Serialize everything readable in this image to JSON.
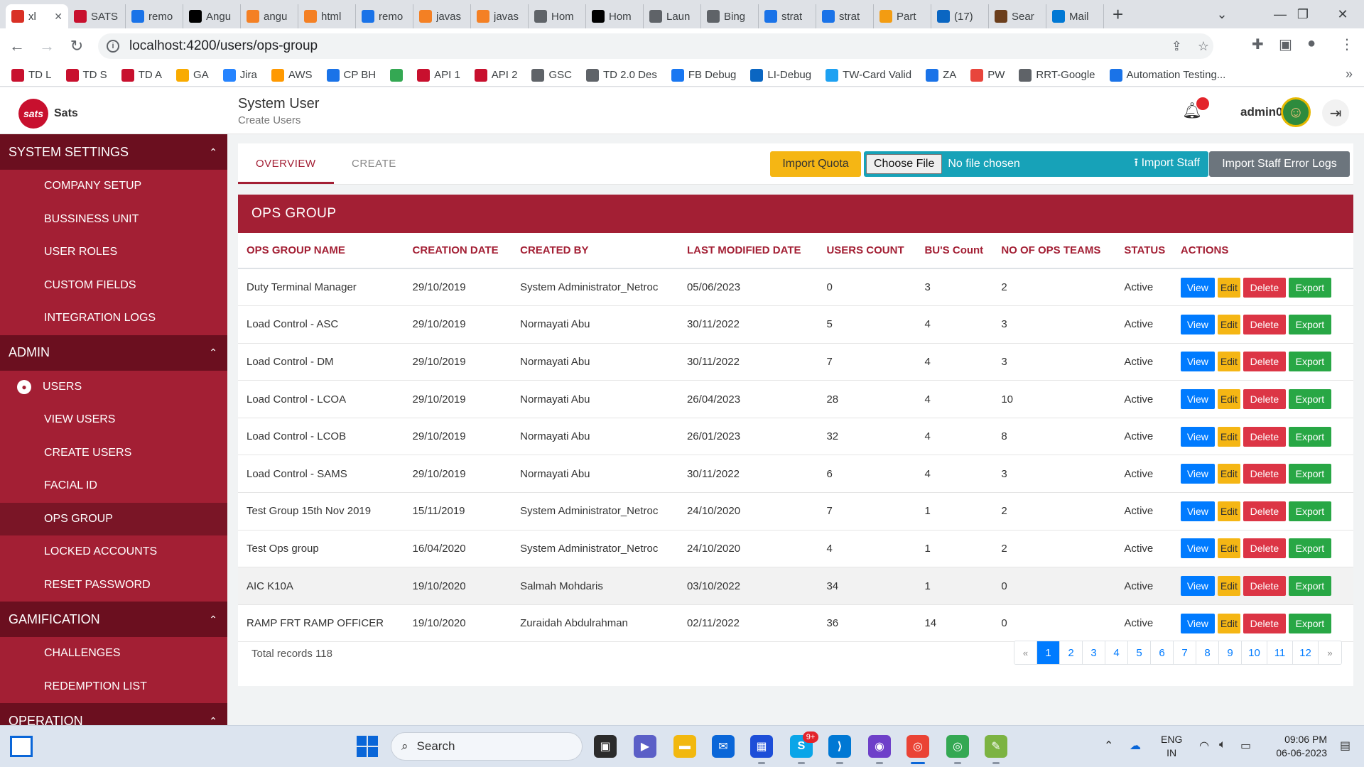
{
  "browser": {
    "tabs": [
      {
        "label": "xl",
        "color": "#d93025",
        "icon": "chrome-loader-icon",
        "active": true
      },
      {
        "label": "SATS",
        "color": "#c8102e",
        "icon": "sats-favicon"
      },
      {
        "label": "remo",
        "color": "#1a73e8",
        "icon": "search-icon"
      },
      {
        "label": "Angu",
        "color": "#000000",
        "icon": "dev-favicon"
      },
      {
        "label": "angu",
        "color": "#f48024",
        "icon": "stackoverflow-favicon"
      },
      {
        "label": "html",
        "color": "#f48024",
        "icon": "stackoverflow-favicon"
      },
      {
        "label": "remo",
        "color": "#1a73e8",
        "icon": "search-icon"
      },
      {
        "label": "javas",
        "color": "#f48024",
        "icon": "stackoverflow-favicon"
      },
      {
        "label": "javas",
        "color": "#f48024",
        "icon": "stackoverflow-favicon"
      },
      {
        "label": "Hom",
        "color": "#5f6368",
        "icon": "doc-favicon"
      },
      {
        "label": "Hom",
        "color": "#000000",
        "icon": "d2l-favicon"
      },
      {
        "label": "Laun",
        "color": "#5f6368",
        "icon": "globe-icon"
      },
      {
        "label": "Bing",
        "color": "#5f6368",
        "icon": "globe-icon"
      },
      {
        "label": "strat",
        "color": "#1a73e8",
        "icon": "search-icon"
      },
      {
        "label": "strat",
        "color": "#1a73e8",
        "icon": "search-icon"
      },
      {
        "label": "Part",
        "color": "#f39c12",
        "icon": "partner-favicon"
      },
      {
        "label": "(17)",
        "color": "#0a66c2",
        "icon": "linkedin-favicon"
      },
      {
        "label": "Sear",
        "color": "#6b3e1c",
        "icon": "ups-favicon"
      },
      {
        "label": "Mail",
        "color": "#0078d4",
        "icon": "outlook-favicon"
      }
    ],
    "new_tab": "+",
    "url": "localhost:4200/users/ops-group",
    "bookmarks": [
      {
        "label": "TD L",
        "color": "#c8102e"
      },
      {
        "label": "TD S",
        "color": "#c8102e"
      },
      {
        "label": "TD A",
        "color": "#c8102e"
      },
      {
        "label": "GA",
        "color": "#f9ab00"
      },
      {
        "label": "Jira",
        "color": "#2684ff"
      },
      {
        "label": "AWS",
        "color": "#ff9900"
      },
      {
        "label": "CP BH",
        "color": "#1a73e8"
      },
      {
        "label": "",
        "color": "#34a853"
      },
      {
        "label": "API 1",
        "color": "#c8102e"
      },
      {
        "label": "API 2",
        "color": "#c8102e"
      },
      {
        "label": "GSC",
        "color": "#5f6368"
      },
      {
        "label": "TD 2.0 Des",
        "color": "#5f6368"
      },
      {
        "label": "FB Debug",
        "color": "#1877f2"
      },
      {
        "label": "LI-Debug",
        "color": "#0a66c2"
      },
      {
        "label": "TW-Card Valid",
        "color": "#1da1f2"
      },
      {
        "label": "ZA",
        "color": "#1a73e8"
      },
      {
        "label": "PW",
        "color": "#e8453c"
      },
      {
        "label": "RRT-Google",
        "color": "#5f6368"
      },
      {
        "label": "Automation Testing...",
        "color": "#1a73e8"
      }
    ],
    "more_bookmarks": "»"
  },
  "header": {
    "brand_logo": "sats",
    "brand_name": "Sats",
    "title": "System User",
    "subtitle": "Create Users",
    "username": "admin001"
  },
  "sidebar": {
    "sections": [
      {
        "title": "SYSTEM SETTINGS",
        "items": [
          "COMPANY SETUP",
          "BUSSINESS UNIT",
          "USER ROLES",
          "CUSTOM FIELDS",
          "INTEGRATION LOGS"
        ]
      },
      {
        "title": "ADMIN",
        "sub_title": "USERS",
        "items": [
          "VIEW USERS",
          "CREATE USERS",
          "FACIAL ID",
          "OPS GROUP",
          "LOCKED ACCOUNTS",
          "RESET PASSWORD"
        ],
        "active": "OPS GROUP"
      },
      {
        "title": "GAMIFICATION",
        "items": [
          "CHALLENGES",
          "REDEMPTION LIST"
        ]
      },
      {
        "title": "OPERATION",
        "items": []
      }
    ]
  },
  "tabs": {
    "overview": "OVERVIEW",
    "create": "CREATE"
  },
  "toolbar": {
    "import_quota": "Import Quota",
    "choose_file": "Choose File",
    "no_file": "No file chosen",
    "import_staff": "Import Staff",
    "error_logs": "Import Staff Error Logs"
  },
  "panel": {
    "title": "OPS GROUP",
    "columns": [
      "OPS GROUP NAME",
      "CREATION DATE",
      "CREATED BY",
      "LAST MODIFIED DATE",
      "USERS COUNT",
      "BU'S Count",
      "NO OF OPS TEAMS",
      "STATUS",
      "ACTIONS"
    ],
    "rows": [
      [
        "Duty Terminal Manager",
        "29/10/2019",
        "System Administrator_Netroc",
        "05/06/2023",
        "0",
        "3",
        "2",
        "Active"
      ],
      [
        "Load Control - ASC",
        "29/10/2019",
        "Normayati Abu",
        "30/11/2022",
        "5",
        "4",
        "3",
        "Active"
      ],
      [
        "Load Control - DM",
        "29/10/2019",
        "Normayati Abu",
        "30/11/2022",
        "7",
        "4",
        "3",
        "Active"
      ],
      [
        "Load Control - LCOA",
        "29/10/2019",
        "Normayati Abu",
        "26/04/2023",
        "28",
        "4",
        "10",
        "Active"
      ],
      [
        "Load Control - LCOB",
        "29/10/2019",
        "Normayati Abu",
        "26/01/2023",
        "32",
        "4",
        "8",
        "Active"
      ],
      [
        "Load Control - SAMS",
        "29/10/2019",
        "Normayati Abu",
        "30/11/2022",
        "6",
        "4",
        "3",
        "Active"
      ],
      [
        "Test Group 15th Nov 2019",
        "15/11/2019",
        "System Administrator_Netroc",
        "24/10/2020",
        "7",
        "1",
        "2",
        "Active"
      ],
      [
        "Test Ops group",
        "16/04/2020",
        "System Administrator_Netroc",
        "24/10/2020",
        "4",
        "1",
        "2",
        "Active"
      ],
      [
        "AIC K10A",
        "19/10/2020",
        "Salmah Mohdaris",
        "03/10/2022",
        "34",
        "1",
        "0",
        "Active"
      ],
      [
        "RAMP FRT RAMP OFFICER",
        "19/10/2020",
        "Zuraidah Abdulrahman",
        "02/11/2022",
        "36",
        "14",
        "0",
        "Active"
      ]
    ],
    "actions": {
      "view": "View",
      "edit": "Edit",
      "delete": "Delete",
      "export": "Export"
    },
    "total_records": "Total records 118",
    "pages": [
      "«",
      "1",
      "2",
      "3",
      "4",
      "5",
      "6",
      "7",
      "8",
      "9",
      "10",
      "11",
      "12",
      "»"
    ],
    "current_page": "1"
  },
  "taskbar": {
    "search": "Search",
    "lang_line1": "ENG",
    "lang_line2": "IN",
    "time": "09:06 PM",
    "date": "06-06-2023",
    "notification_badge": "9+"
  },
  "colors": {
    "brand": "#a31f34",
    "brand_dark": "#6b0f1f",
    "primary": "#007bff",
    "warning": "#f5b614",
    "danger": "#dc3545",
    "success": "#28a745",
    "info": "#17a2b8"
  }
}
